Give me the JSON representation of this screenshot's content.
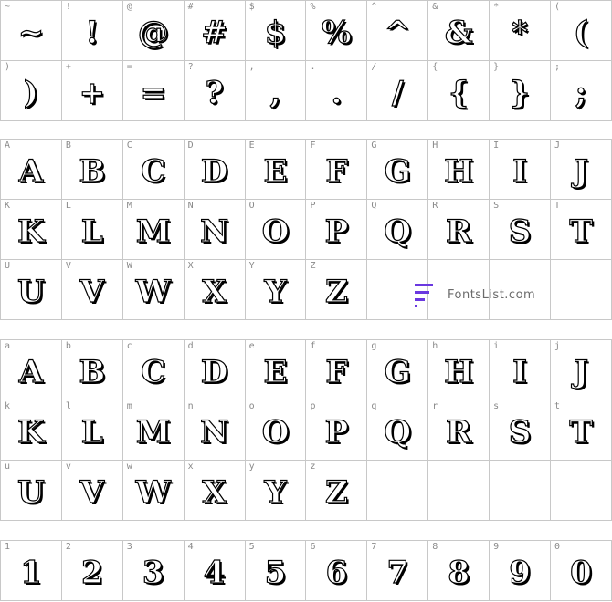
{
  "sections": [
    {
      "rows": [
        [
          [
            "~",
            "~"
          ],
          [
            "!",
            "!"
          ],
          [
            "@",
            "@"
          ],
          [
            "#",
            "#"
          ],
          [
            "$",
            "$"
          ],
          [
            "%",
            "%"
          ],
          [
            "^",
            "^"
          ],
          [
            "&",
            "&"
          ],
          [
            "*",
            "*"
          ],
          [
            "(",
            "("
          ]
        ],
        [
          [
            ")",
            ")"
          ],
          [
            "+",
            "+"
          ],
          [
            "=",
            "="
          ],
          [
            "?",
            "?"
          ],
          [
            ",",
            ","
          ],
          [
            ".",
            "."
          ],
          [
            "/",
            "/"
          ],
          [
            "{",
            "{"
          ],
          [
            "}",
            "}"
          ],
          [
            ";",
            ";"
          ]
        ]
      ]
    },
    {
      "rows": [
        [
          [
            "A",
            "A"
          ],
          [
            "B",
            "B"
          ],
          [
            "C",
            "C"
          ],
          [
            "D",
            "D"
          ],
          [
            "E",
            "E"
          ],
          [
            "F",
            "F"
          ],
          [
            "G",
            "G"
          ],
          [
            "H",
            "H"
          ],
          [
            "I",
            "I"
          ],
          [
            "J",
            "J"
          ]
        ],
        [
          [
            "K",
            "K"
          ],
          [
            "L",
            "L"
          ],
          [
            "M",
            "M"
          ],
          [
            "N",
            "N"
          ],
          [
            "O",
            "O"
          ],
          [
            "P",
            "P"
          ],
          [
            "Q",
            "Q"
          ],
          [
            "R",
            "R"
          ],
          [
            "S",
            "S"
          ],
          [
            "T",
            "T"
          ]
        ],
        [
          [
            "U",
            "U"
          ],
          [
            "V",
            "V"
          ],
          [
            "W",
            "W"
          ],
          [
            "X",
            "X"
          ],
          [
            "Y",
            "Y"
          ],
          [
            "Z",
            "Z"
          ],
          [
            "",
            ""
          ],
          [
            "",
            ""
          ],
          [
            "",
            ""
          ],
          [
            "",
            ""
          ]
        ]
      ]
    },
    {
      "rows": [
        [
          [
            "a",
            "A"
          ],
          [
            "b",
            "B"
          ],
          [
            "c",
            "C"
          ],
          [
            "d",
            "D"
          ],
          [
            "e",
            "E"
          ],
          [
            "f",
            "F"
          ],
          [
            "g",
            "G"
          ],
          [
            "h",
            "H"
          ],
          [
            "i",
            "I"
          ],
          [
            "j",
            "J"
          ]
        ],
        [
          [
            "k",
            "K"
          ],
          [
            "l",
            "L"
          ],
          [
            "m",
            "M"
          ],
          [
            "n",
            "N"
          ],
          [
            "o",
            "O"
          ],
          [
            "p",
            "P"
          ],
          [
            "q",
            "Q"
          ],
          [
            "r",
            "R"
          ],
          [
            "s",
            "S"
          ],
          [
            "t",
            "T"
          ]
        ],
        [
          [
            "u",
            "U"
          ],
          [
            "v",
            "V"
          ],
          [
            "w",
            "W"
          ],
          [
            "x",
            "X"
          ],
          [
            "y",
            "Y"
          ],
          [
            "z",
            "Z"
          ],
          [
            "",
            ""
          ],
          [
            "",
            ""
          ],
          [
            "",
            ""
          ],
          [
            "",
            ""
          ]
        ]
      ]
    },
    {
      "rows": [
        [
          [
            "1",
            "1"
          ],
          [
            "2",
            "2"
          ],
          [
            "3",
            "3"
          ],
          [
            "4",
            "4"
          ],
          [
            "5",
            "5"
          ],
          [
            "6",
            "6"
          ],
          [
            "7",
            "7"
          ],
          [
            "8",
            "8"
          ],
          [
            "9",
            "9"
          ],
          [
            "0",
            "0"
          ]
        ]
      ]
    }
  ],
  "watermark": {
    "text": "FontsList.com",
    "icon": "fontslist-logo-icon",
    "color": "#6a38e0"
  }
}
